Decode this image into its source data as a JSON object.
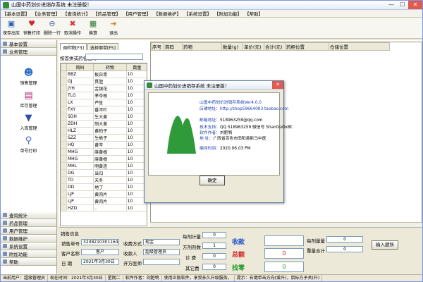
{
  "app": {
    "title": "山国中药划价进销存系统 未注册版！",
    "window_buttons": [
      "—",
      "☐",
      "✕"
    ]
  },
  "menu": [
    "【基本设置】",
    "【业务管理】",
    "【查询统计】",
    "【药品管理】",
    "【用户管理】",
    "【数据维护】",
    "【系统设置】",
    "【附加功能】",
    "【帮助】"
  ],
  "toolbar": [
    {
      "label": "保存出库",
      "icon": "save-icon"
    },
    {
      "label": "销售打印",
      "icon": "heart-print-icon"
    },
    {
      "label": "删除一行",
      "icon": "delete-row-icon"
    },
    {
      "label": "取消操作",
      "icon": "undo-icon"
    },
    {
      "label": "换算",
      "icon": "calc-icon"
    },
    {
      "label": "退出",
      "icon": "exit-icon"
    }
  ],
  "sidebar": {
    "top": [
      {
        "label": "基本设置"
      },
      {
        "label": "业务管理"
      }
    ],
    "tools": [
      {
        "label": "销售管理",
        "icon": "sales-icon"
      },
      {
        "label": "库存管理",
        "icon": "stock-icon"
      },
      {
        "label": "入库管理",
        "icon": "inbound-icon"
      },
      {
        "label": "单号打印",
        "icon": "number-print-icon"
      }
    ],
    "bottom": [
      {
        "label": "查询统计"
      },
      {
        "label": "药品管理"
      },
      {
        "label": "用户管理"
      },
      {
        "label": "数据维护"
      },
      {
        "label": "系统设置"
      },
      {
        "label": "附加功能"
      },
      {
        "label": "帮助"
      }
    ]
  },
  "tabs": [
    "调药物[F3]",
    "选择哪单[F5]"
  ],
  "search": {
    "label": "按首拼或药名查询",
    "value": ""
  },
  "med_table": {
    "headers": [
      "简码",
      "药物",
      "数量"
    ],
    "rows": [
      [
        "BBZ",
        "板白青",
        "10"
      ],
      [
        "GJ",
        "贯胆",
        "10"
      ],
      [
        "JYH",
        "金银花",
        "10"
      ],
      [
        "TLG",
        "茅苓根",
        "10"
      ],
      [
        "LX",
        "芦笙",
        "10"
      ],
      [
        "FXY",
        "番泻叶",
        "10"
      ],
      [
        "SDH",
        "生大黄",
        "10"
      ],
      [
        "ZDH",
        "制大黄",
        "10"
      ],
      [
        "HLZ",
        "黄柏子",
        "10"
      ],
      [
        "SZZ",
        "生桅子",
        "10"
      ],
      [
        "HQ",
        "黄芩",
        "10"
      ],
      [
        "MHG",
        "麻黄根",
        "10"
      ],
      [
        "MHG",
        "麻黄根",
        "10"
      ],
      [
        "MHL",
        "明黄连",
        "10"
      ],
      [
        "DG",
        "当归",
        "10"
      ],
      [
        "TD",
        "天冬",
        "10"
      ],
      [
        "DD",
        "地丁",
        "10"
      ],
      [
        "LJP",
        "黄肉片",
        "10"
      ],
      [
        "LJP",
        "黄肉片",
        "10"
      ],
      [
        "HZD",
        "..",
        "10"
      ]
    ]
  },
  "grid": {
    "headers": [
      "序号",
      "简码",
      "药物",
      "数量(g)",
      "单价(元)",
      "合计(元)",
      "药柜位置",
      "仓储位置"
    ]
  },
  "sales_info": {
    "title": "销售信息",
    "order_no_label": "销售单号",
    "order_no": "32082103011644800",
    "customer_label": "客户名称",
    "customer": "客户",
    "date_label": "日  期",
    "date": "2021年3月30日",
    "payment_label": "收费方式",
    "payment": "现金",
    "cashier_label": "收款人",
    "cashier": "超级管理员",
    "prescriber_label": "开方医师",
    "prescriber": "",
    "per_dose_label": "每剂计量",
    "per_dose": "0",
    "doses_label": "方剂剂数",
    "doses": "1",
    "fee_label": "诊  费",
    "fee": "0",
    "other_label": "其它费",
    "other": "0",
    "receive_label": "收款",
    "receive": "",
    "total_label": "总额",
    "total": "0",
    "change_label": "找零",
    "change": "0",
    "per_weight_label": "每剂量量",
    "per_weight": "0",
    "weight_total_label": "重量合计",
    "weight_total": "0",
    "print_button": "输入厨所"
  },
  "status": [
    "当前用户：超级管理员",
    "现在时间：2021年3月30日",
    "星期二",
    "软件作者：刘肥鸭",
    "使用正版软件，享受永久升级服务。",
    "提示：右键单击方向(爱升)，鼠标方予关(升)"
  ],
  "about_dialog": {
    "title": "山国中药划价进销存系统 未注册版！",
    "product": "山国中药划价进销存系统Ver4.0.0",
    "shop_label": "店铺地址：http://shop59664083.taobao.com",
    "email_label": "邮箱地址：",
    "email": "518963259@qq.com",
    "support_label": "技术支持：",
    "support": "QQ 518963259   微信号 ShanGuOxBt",
    "author_label": "软件作者：",
    "author": "刘肥鸭",
    "unit_label": "地      址：",
    "unit": "广西省百色市田阳县新马中医",
    "date_label": "编译时间：",
    "date": "2020.06.03 PM",
    "ok_button": "确定",
    "logo_color": "#2e9a3a"
  }
}
